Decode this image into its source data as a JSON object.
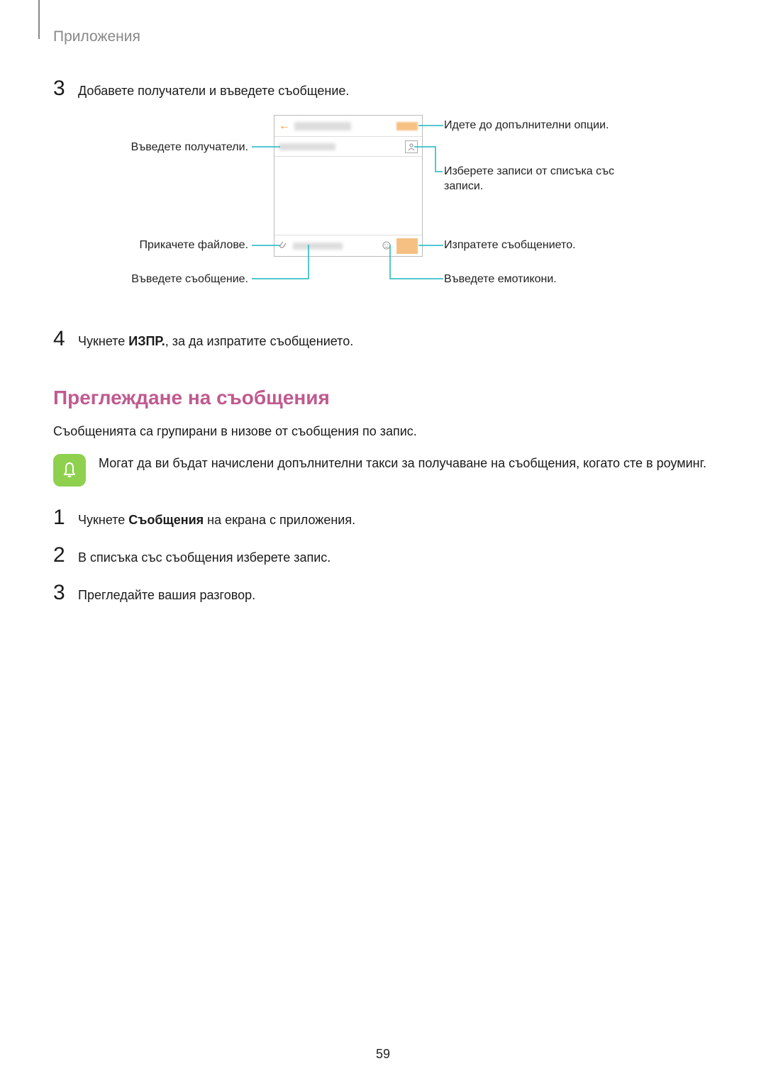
{
  "header": {
    "title": "Приложения"
  },
  "step3": {
    "num": "3",
    "text": "Добавете получатели и въведете съобщение."
  },
  "callouts": {
    "recipients": "Въведете получатели.",
    "attach": "Прикачете файлове.",
    "enter_msg": "Въведете съобщение.",
    "more": "Идете до допълнителни опции.",
    "contacts": "Изберете записи от списъка със записи.",
    "send": "Изпратете съобщението.",
    "emoji": "Въведете емотикони."
  },
  "step4": {
    "num": "4",
    "pre": "Чукнете ",
    "bold": "ИЗПР.",
    "post": ", за да изпратите съобщението."
  },
  "section_heading": "Преглеждане на съобщения",
  "para1": "Съобщенията са групирани в низове от съобщения по запис.",
  "note": "Могат да ви бъдат начислени допълнителни такси за получаване на съобщения, когато сте в роуминг.",
  "view_steps": {
    "s1": {
      "num": "1",
      "pre": "Чукнете ",
      "bold": "Съобщения",
      "post": " на екрана с приложения."
    },
    "s2": {
      "num": "2",
      "text": "В списъка със съобщения изберете запис."
    },
    "s3": {
      "num": "3",
      "text": "Прегледайте вашия разговор."
    }
  },
  "page_number": "59"
}
